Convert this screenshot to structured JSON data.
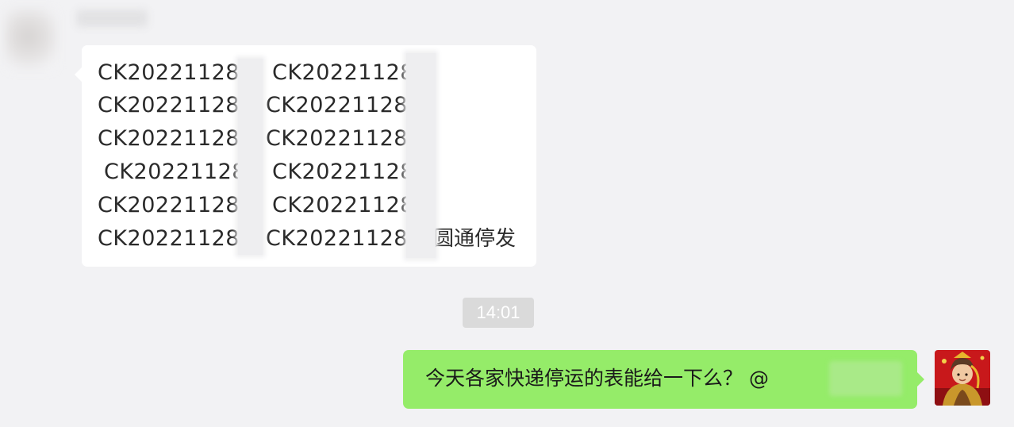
{
  "incoming_message": {
    "lines": [
      {
        "left": "CK20221128",
        "right": "CK20221128"
      },
      {
        "left": "CK20221128",
        "right": "CK20221128"
      },
      {
        "left": "CK20221128",
        "right": "CK20221128"
      },
      {
        "left": "CK20221128",
        "right": "CK20221128"
      },
      {
        "left": "CK20221128",
        "right": "CK20221128"
      },
      {
        "left": "CK20221128",
        "right": "CK20221128"
      }
    ],
    "suffix": "圆通停发"
  },
  "timestamp": "14:01",
  "outgoing_message": {
    "text": "今天各家快递停运的表能给一下么？ @"
  },
  "colors": {
    "background": "#f2f2f4",
    "incoming_bubble": "#ffffff",
    "outgoing_bubble": "#95ec69",
    "timestamp_badge": "#dadada"
  }
}
